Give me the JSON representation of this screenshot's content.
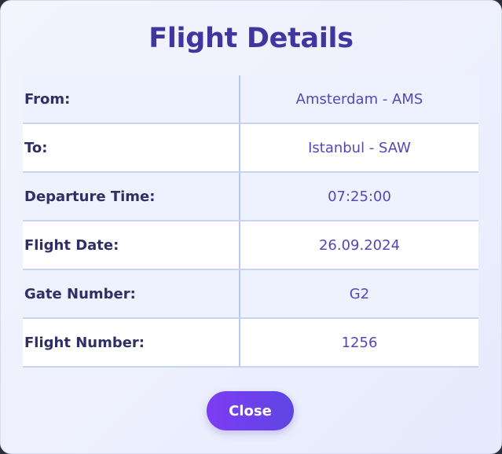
{
  "dialog": {
    "title": "Flight Details",
    "rows": [
      {
        "label": "From:",
        "value": "Amsterdam - AMS"
      },
      {
        "label": "To:",
        "value": "Istanbul - SAW"
      },
      {
        "label": "Departure Time:",
        "value": "07:25:00"
      },
      {
        "label": "Flight Date:",
        "value": "26.09.2024"
      },
      {
        "label": "Gate Number:",
        "value": "G2"
      },
      {
        "label": "Flight Number:",
        "value": "1256"
      }
    ],
    "close_label": "Close"
  },
  "colors": {
    "title": "#3f36a0",
    "label": "#2f2f66",
    "value": "#5248b8",
    "button_start": "#7d3cf2",
    "button_end": "#5f45e3",
    "row_alt": "#eef2fe",
    "divider": "#c7d4f6"
  }
}
